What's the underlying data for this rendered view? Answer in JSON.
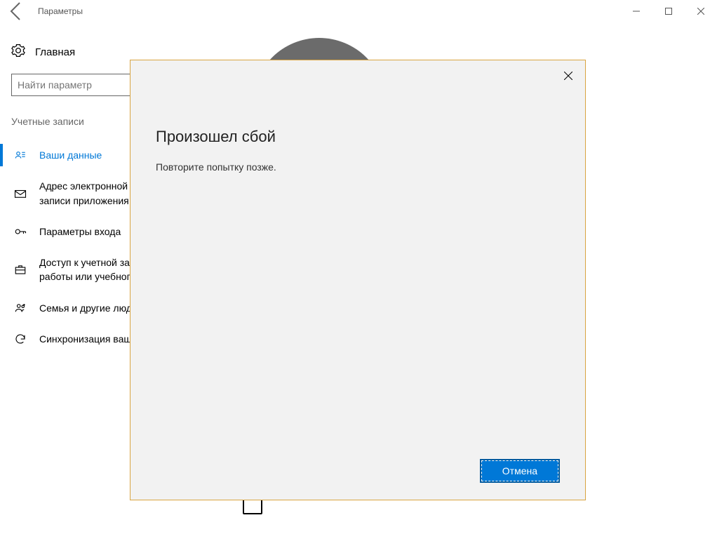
{
  "window": {
    "title": "Параметры"
  },
  "sidebar": {
    "home_label": "Главная",
    "search_placeholder": "Найти параметр",
    "section_label": "Учетные записи",
    "items": [
      {
        "label": "Ваши данные"
      },
      {
        "label": "Адрес электронной почты; учетные записи приложения"
      },
      {
        "label": "Параметры входа"
      },
      {
        "label": "Доступ к учетной записи места работы или учебного заведения"
      },
      {
        "label": "Семья и другие люди"
      },
      {
        "label": "Синхронизация ваших параметров"
      }
    ]
  },
  "dialog": {
    "title": "Произошел сбой",
    "message": "Повторите попытку позже.",
    "cancel_label": "Отмена"
  }
}
